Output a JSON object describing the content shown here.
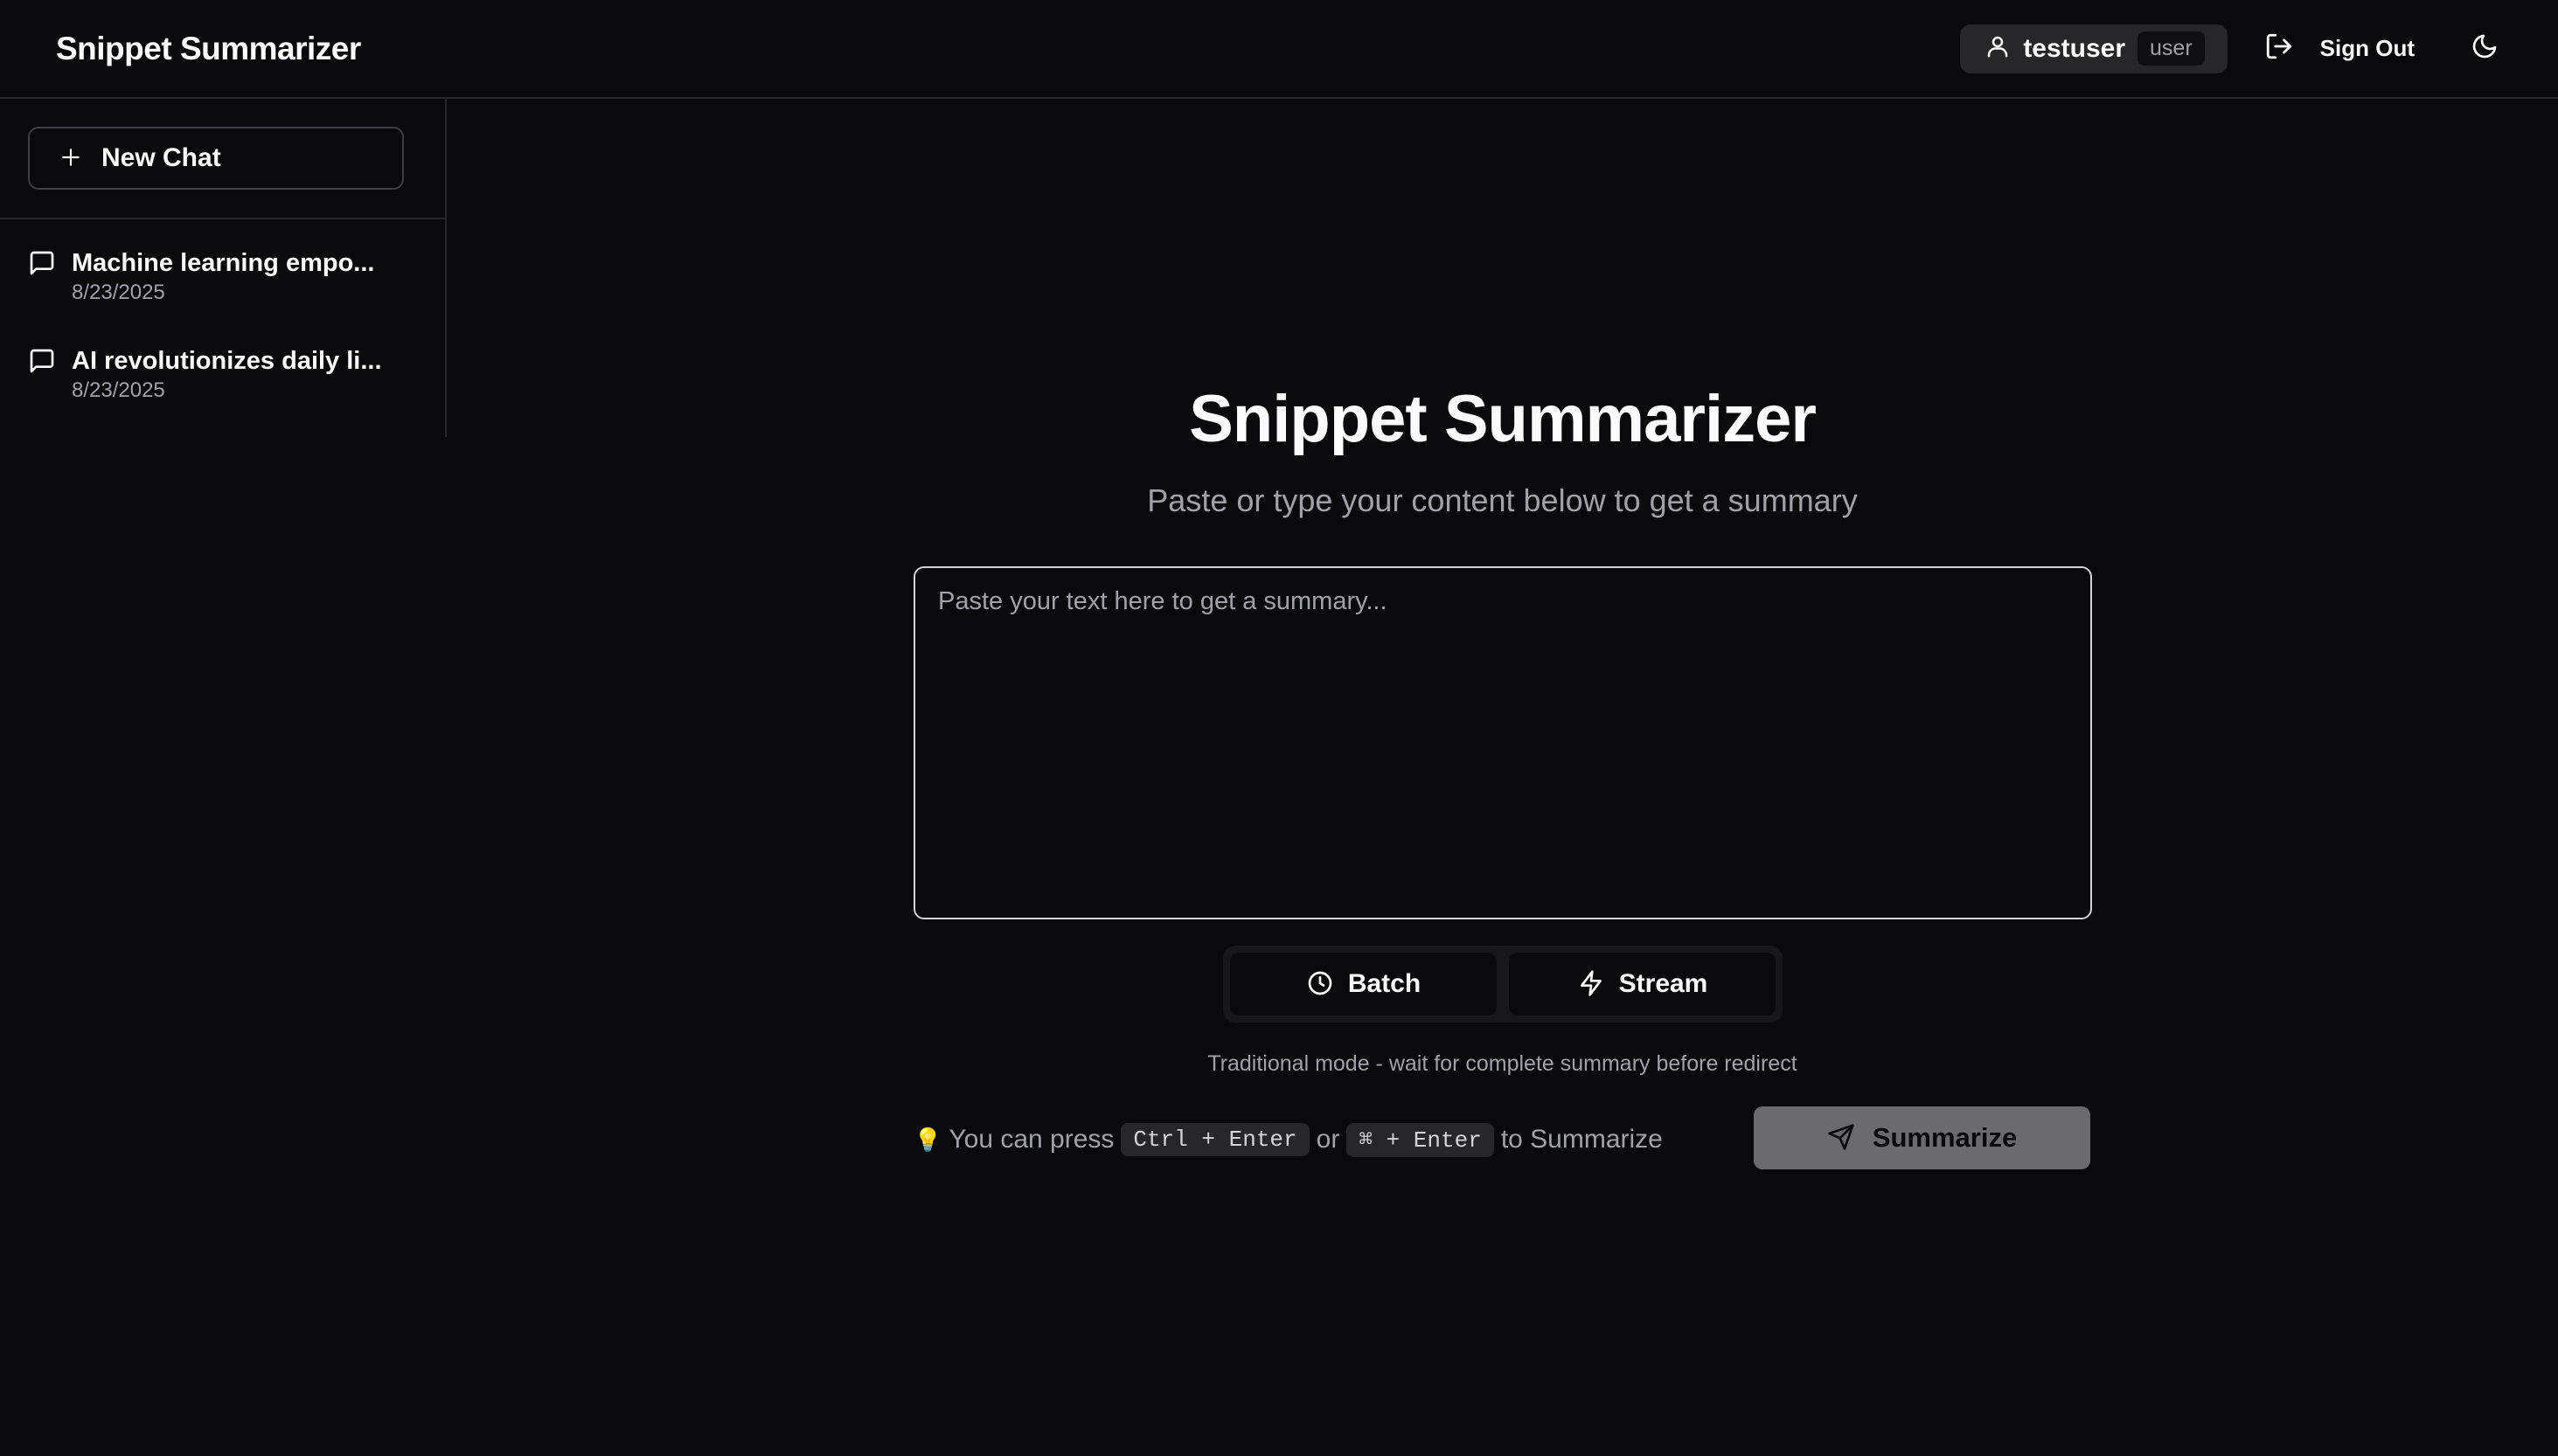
{
  "header": {
    "app_title": "Snippet Summarizer",
    "username": "testuser",
    "role": "user",
    "sign_out_label": "Sign Out"
  },
  "sidebar": {
    "new_chat_label": "New Chat",
    "chats": [
      {
        "title": "Machine learning empo...",
        "date": "8/23/2025"
      },
      {
        "title": "AI revolutionizes daily li...",
        "date": "8/23/2025"
      }
    ]
  },
  "main": {
    "title": "Snippet Summarizer",
    "subtitle": "Paste or type your content below to get a summary",
    "input_placeholder": "Paste your text here to get a summary...",
    "input_value": "",
    "modes": [
      {
        "label": "Batch",
        "icon": "clock-icon"
      },
      {
        "label": "Stream",
        "icon": "zap-icon"
      }
    ],
    "mode_description": "Traditional mode - wait for complete summary before redirect",
    "hint": {
      "bulb": "💡",
      "prefix": "You can press",
      "key1": "Ctrl + Enter",
      "or": "or",
      "key2": "⌘ + Enter",
      "suffix": "to Summarize"
    },
    "summarize_label": "Summarize"
  },
  "colors": {
    "background": "#0a0a0c",
    "border": "#27272a",
    "muted_text": "#a1a1aa",
    "summarize_button": "#6b6b6e"
  }
}
